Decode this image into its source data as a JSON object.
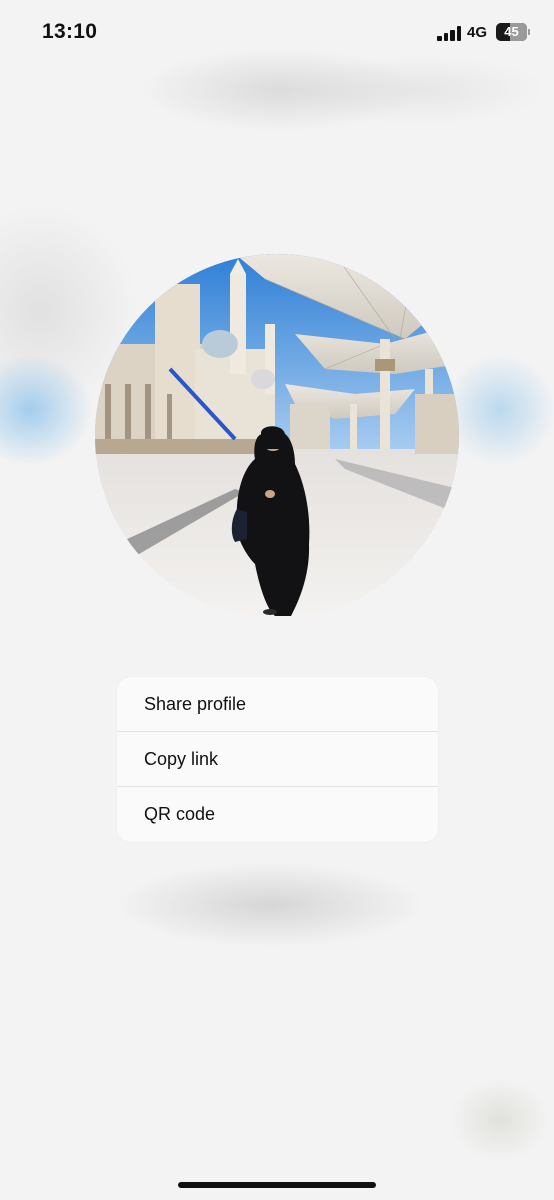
{
  "status_bar": {
    "time": "13:10",
    "network": "4G",
    "battery_percent": "45",
    "signal_icon": "cellular-signal-icon",
    "battery_icon": "battery-icon"
  },
  "profile": {
    "avatar_alt": "profile picture"
  },
  "menu": {
    "items": [
      {
        "label": "Share profile"
      },
      {
        "label": "Copy link"
      },
      {
        "label": "QR code"
      }
    ]
  },
  "colors": {
    "background": "#f3f3f3",
    "menu_bg": "#fafafa",
    "text": "#111111",
    "divider": "#e2e2e2"
  }
}
